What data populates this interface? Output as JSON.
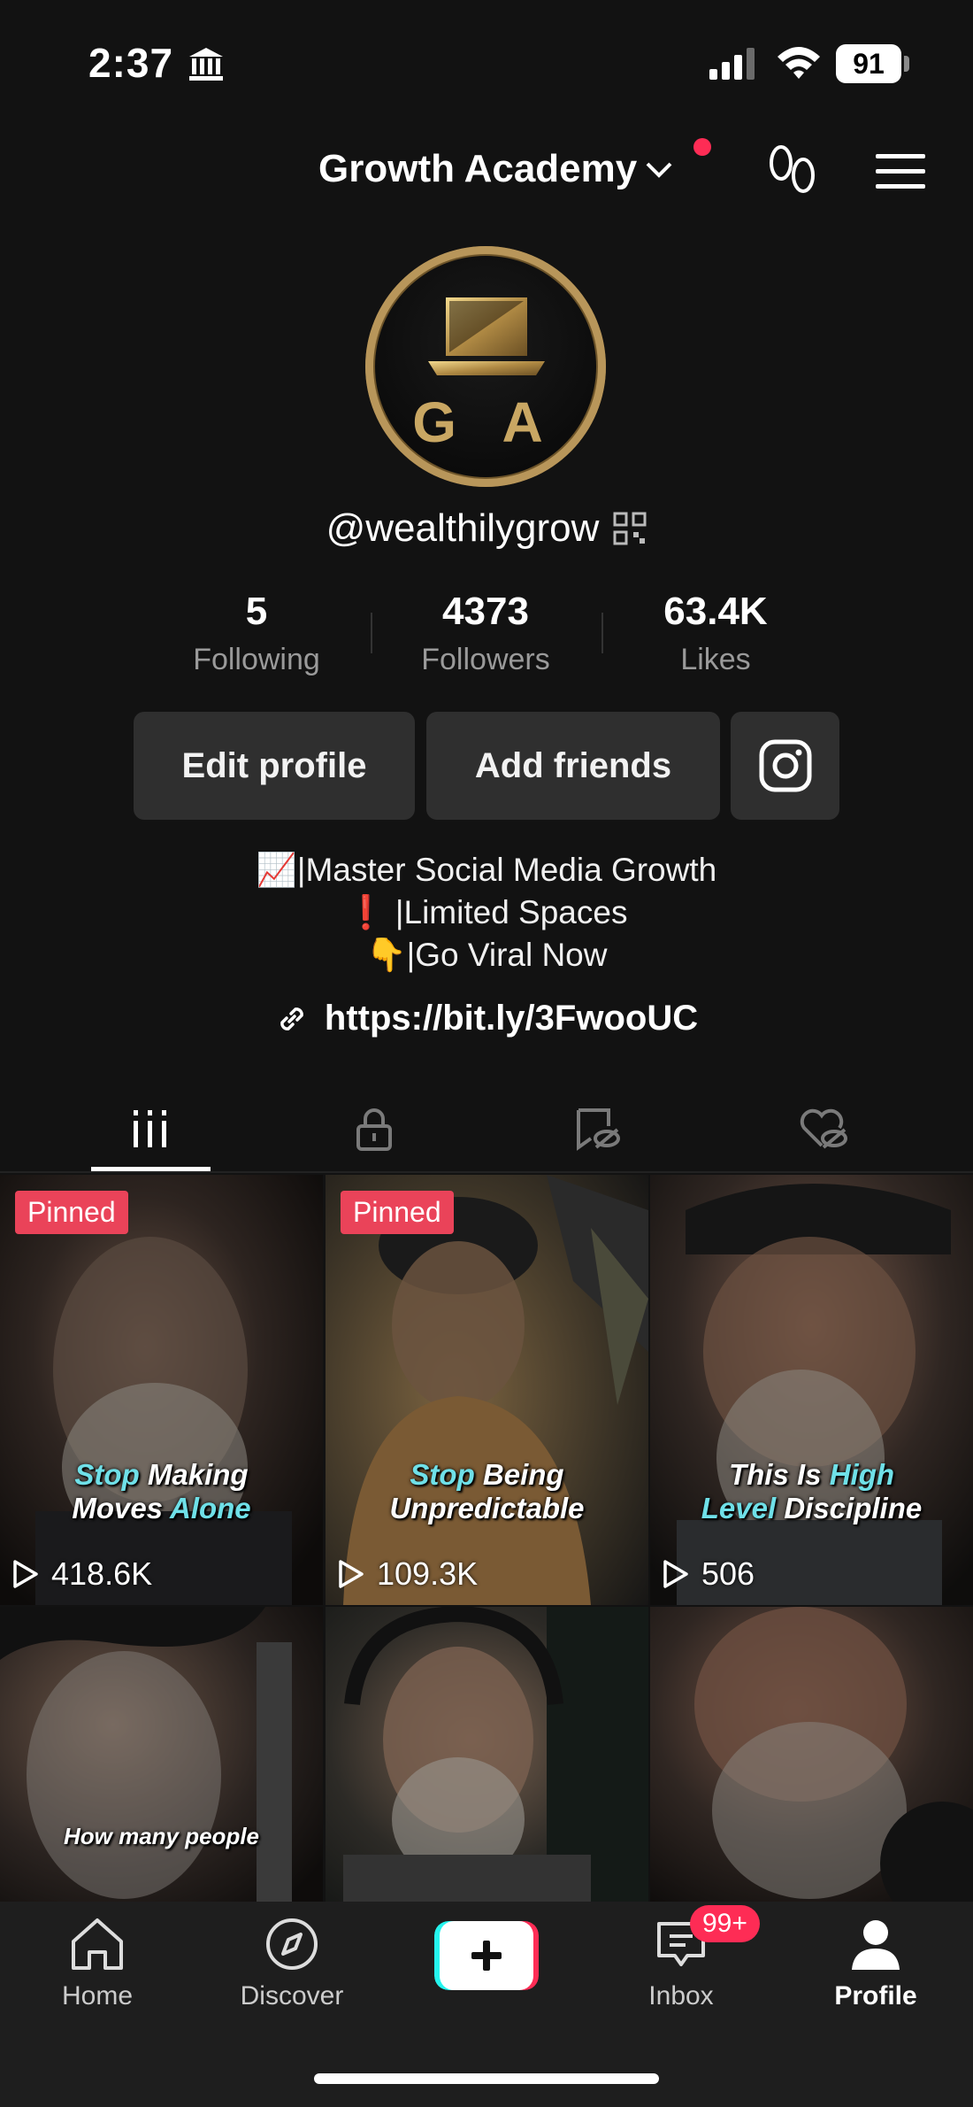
{
  "status_bar": {
    "time": "2:37",
    "battery": "91"
  },
  "header": {
    "account_name": "Growth Academy"
  },
  "profile": {
    "avatar_letters": "G A",
    "username": "@wealthilygrow",
    "stats": [
      {
        "value": "5",
        "label": "Following"
      },
      {
        "value": "4373",
        "label": "Followers"
      },
      {
        "value": "63.4K",
        "label": "Likes"
      }
    ],
    "buttons": {
      "edit": "Edit profile",
      "add_friends": "Add friends"
    },
    "bio": [
      "📈|Master Social Media Growth",
      "❗ |Limited Spaces",
      "👇|Go Viral Now"
    ],
    "link": "https://bit.ly/3FwooUC"
  },
  "tabs": [
    "videos-icon",
    "lock-icon",
    "repost-icon",
    "liked-icon"
  ],
  "videos": [
    {
      "pinned": "Pinned",
      "caption": [
        "Stop",
        " Making",
        "Moves ",
        "Alone"
      ],
      "views": "418.6K"
    },
    {
      "pinned": "Pinned",
      "caption": [
        "Stop",
        " Being",
        "Unpredictable",
        ""
      ],
      "views": "109.3K"
    },
    {
      "pinned": "",
      "caption": [
        "This Is ",
        "High",
        "Level",
        " Discipline"
      ],
      "views": "506"
    },
    {
      "pinned": "",
      "caption": [
        "How many people",
        "",
        "",
        ""
      ],
      "views": ""
    },
    {
      "pinned": "",
      "caption": [
        "",
        "",
        "",
        ""
      ],
      "views": ""
    },
    {
      "pinned": "",
      "caption": [
        "",
        "",
        "",
        ""
      ],
      "views": ""
    }
  ],
  "nav": {
    "home": "Home",
    "discover": "Discover",
    "inbox": "Inbox",
    "inbox_badge": "99+",
    "profile": "Profile"
  },
  "colors": {
    "accent": "#fe2c55",
    "highlight": "#6fe0e8",
    "gold": "#b8965a"
  }
}
